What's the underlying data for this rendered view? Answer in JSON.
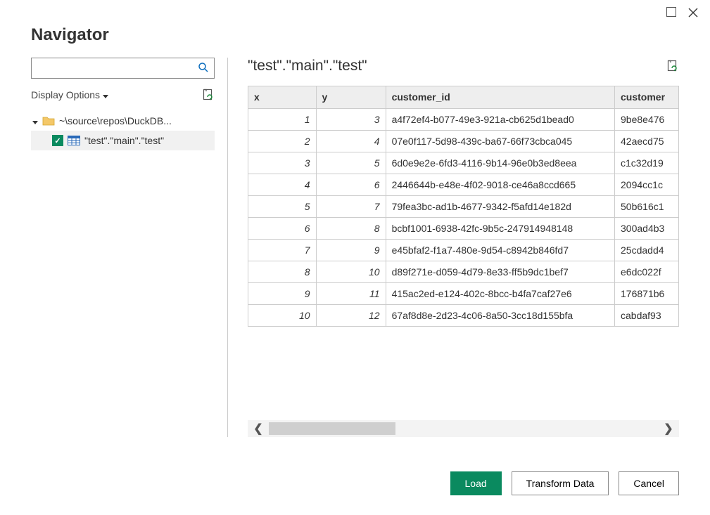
{
  "window": {
    "title": "Navigator"
  },
  "sidebar": {
    "display_options_label": "Display Options",
    "search_placeholder": "",
    "tree": {
      "root_label": "~\\source\\repos\\DuckDB...",
      "child_label": "\"test\".\"main\".\"test\"",
      "child_checked": true
    }
  },
  "preview": {
    "title": "\"test\".\"main\".\"test\"",
    "columns": [
      {
        "key": "x",
        "label": "x",
        "align": "right"
      },
      {
        "key": "y",
        "label": "y",
        "align": "right"
      },
      {
        "key": "customer_id",
        "label": "customer_id",
        "align": "left"
      },
      {
        "key": "customer_name",
        "label": "customer",
        "align": "left"
      }
    ],
    "rows": [
      {
        "x": 1,
        "y": 3,
        "customer_id": "a4f72ef4-b077-49e3-921a-cb625d1bead0",
        "customer_name": "9be8e476"
      },
      {
        "x": 2,
        "y": 4,
        "customer_id": "07e0f117-5d98-439c-ba67-66f73cbca045",
        "customer_name": "42aecd75"
      },
      {
        "x": 3,
        "y": 5,
        "customer_id": "6d0e9e2e-6fd3-4116-9b14-96e0b3ed8eea",
        "customer_name": "c1c32d19"
      },
      {
        "x": 4,
        "y": 6,
        "customer_id": "2446644b-e48e-4f02-9018-ce46a8ccd665",
        "customer_name": "2094cc1c"
      },
      {
        "x": 5,
        "y": 7,
        "customer_id": "79fea3bc-ad1b-4677-9342-f5afd14e182d",
        "customer_name": "50b616c1"
      },
      {
        "x": 6,
        "y": 8,
        "customer_id": "bcbf1001-6938-42fc-9b5c-247914948148",
        "customer_name": "300ad4b3"
      },
      {
        "x": 7,
        "y": 9,
        "customer_id": "e45bfaf2-f1a7-480e-9d54-c8942b846fd7",
        "customer_name": "25cdadd4"
      },
      {
        "x": 8,
        "y": 10,
        "customer_id": "d89f271e-d059-4d79-8e33-ff5b9dc1bef7",
        "customer_name": "e6dc022f"
      },
      {
        "x": 9,
        "y": 11,
        "customer_id": "415ac2ed-e124-402c-8bcc-b4fa7caf27e6",
        "customer_name": "176871b6"
      },
      {
        "x": 10,
        "y": 12,
        "customer_id": "67af8d8e-2d23-4c06-8a50-3cc18d155bfa",
        "customer_name": "cabdaf93"
      }
    ]
  },
  "buttons": {
    "load": "Load",
    "transform": "Transform Data",
    "cancel": "Cancel"
  }
}
